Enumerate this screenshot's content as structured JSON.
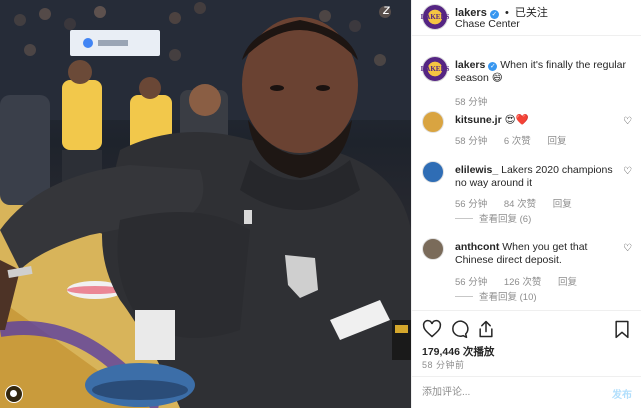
{
  "header": {
    "username": "lakers",
    "separator": "•",
    "follow_status": "已关注",
    "location": "Chase Center",
    "avatar_text": "LAKERS"
  },
  "caption": {
    "username": "lakers",
    "text": "When it's finally the regular season",
    "emoji": "😄",
    "time": "58 分钟"
  },
  "comments": [
    {
      "username": "kitsune.jr",
      "text": "😍❤️",
      "time": "58 分钟",
      "likes": "6 次赞",
      "reply": "回复",
      "view_replies": "",
      "avatar_color": "#d9a441"
    },
    {
      "username": "elilewis_",
      "text": "Lakers 2020 champions no way around it",
      "time": "56 分钟",
      "likes": "84 次赞",
      "reply": "回复",
      "view_replies": "查看回复 (6)",
      "avatar_color": "#2f6db5"
    },
    {
      "username": "anthcont",
      "text": "When you get that Chinese direct deposit.",
      "time": "56 分钟",
      "likes": "126 次赞",
      "reply": "回复",
      "view_replies": "查看回复 (10)",
      "avatar_color": "#7a6b5a"
    }
  ],
  "actions": {
    "icons": [
      "heart-icon",
      "comment-icon",
      "share-icon",
      "bookmark-icon"
    ],
    "views": "179,446 次播放",
    "post_time": "58 分钟前"
  },
  "add_comment": {
    "placeholder": "添加评论...",
    "post_label": "发布"
  },
  "colors": {
    "lakers_purple": "#552583",
    "lakers_gold": "#fdb927",
    "verified_blue": "#3897f0",
    "post_button": "#b2dffc",
    "heart_red": "#ed4956"
  }
}
